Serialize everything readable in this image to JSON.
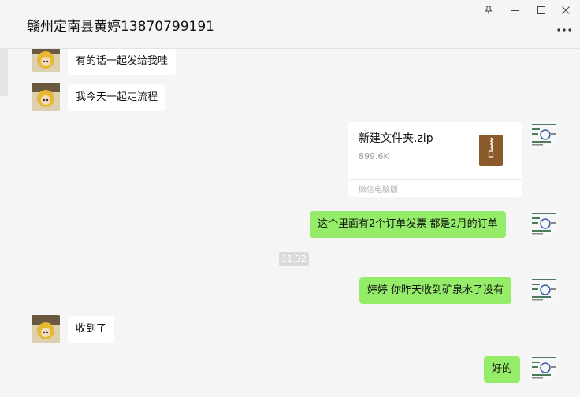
{
  "window": {
    "title": "赣州定南县黄婷13870799191",
    "icons": [
      "pin-icon",
      "minimize-icon",
      "maximize-icon",
      "close-icon",
      "more-icon"
    ]
  },
  "messages": [
    {
      "id": "m1",
      "side": "in",
      "text": "有的话一起发给我哇"
    },
    {
      "id": "m2",
      "side": "in",
      "text": "我今天一起走流程"
    },
    {
      "id": "m3",
      "side": "out",
      "type": "file",
      "file_name": "新建文件夹.zip",
      "file_size": "899.6K",
      "source": "微信电脑版",
      "icon": "zip-file-icon"
    },
    {
      "id": "m4",
      "side": "out",
      "text": "这个里面有2个订单发票  都是2月的订单"
    },
    {
      "id": "t1",
      "type": "time",
      "text": "11:32"
    },
    {
      "id": "m5",
      "side": "out",
      "text": "婷婷 你昨天收到矿泉水了没有"
    },
    {
      "id": "m6",
      "side": "in",
      "text": "收到了"
    },
    {
      "id": "m7",
      "side": "out",
      "text": "好的"
    }
  ],
  "colors": {
    "background": "#f5f5f5",
    "bubble_in": "#ffffff",
    "bubble_out": "#95ec69",
    "zip_icon": "#8b5a2b"
  }
}
